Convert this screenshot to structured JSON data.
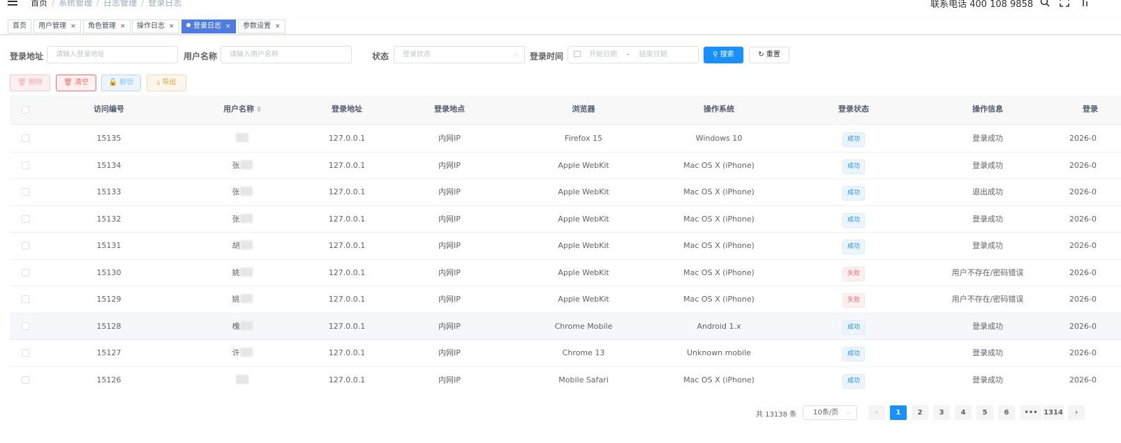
{
  "header": {
    "breadcrumb": [
      "首页",
      "系统管理",
      "日志管理",
      "登录日志"
    ],
    "hotline": "联系电话 400 108 9858"
  },
  "tags": [
    {
      "label": "首页",
      "active": false
    },
    {
      "label": "用户管理",
      "active": false
    },
    {
      "label": "角色管理",
      "active": false
    },
    {
      "label": "操作日志",
      "active": false
    },
    {
      "label": "登录日志",
      "active": true
    },
    {
      "label": "参数设置",
      "active": false
    }
  ],
  "tag_close": "×",
  "filters": {
    "address_label": "登录地址",
    "address_placeholder": "请输入登录地址",
    "username_label": "用户名称",
    "username_placeholder": "请输入用户名称",
    "status_label": "状态",
    "status_placeholder": "登录状态",
    "time_label": "登录时间",
    "start_placeholder": "开始日期",
    "range_sep": "-",
    "end_placeholder": "结束日期",
    "search_label": "搜索",
    "reset_label": "重置"
  },
  "toolbar": {
    "delete_label": "删除",
    "clear_label": "清空",
    "unlock_label": "解锁",
    "export_label": "导出"
  },
  "table": {
    "columns": [
      "访问编号",
      "用户名称",
      "登录地址",
      "登录地点",
      "浏览器",
      "操作系统",
      "登录状态",
      "操作信息",
      "登录"
    ],
    "rows": [
      {
        "id": "15135",
        "user": "",
        "ip": "127.0.0.1",
        "location": "内网IP",
        "browser": "Firefox 15",
        "os": "Windows 10",
        "status": "成功",
        "status_type": "ok",
        "msg": "登录成功",
        "time": "2026-0"
      },
      {
        "id": "15134",
        "user": "张",
        "ip": "127.0.0.1",
        "location": "内网IP",
        "browser": "Apple WebKit",
        "os": "Mac OS X (iPhone)",
        "status": "成功",
        "status_type": "ok",
        "msg": "登录成功",
        "time": "2026-0"
      },
      {
        "id": "15133",
        "user": "张",
        "ip": "127.0.0.1",
        "location": "内网IP",
        "browser": "Apple WebKit",
        "os": "Mac OS X (iPhone)",
        "status": "成功",
        "status_type": "ok",
        "msg": "退出成功",
        "time": "2026-0"
      },
      {
        "id": "15132",
        "user": "张",
        "ip": "127.0.0.1",
        "location": "内网IP",
        "browser": "Apple WebKit",
        "os": "Mac OS X (iPhone)",
        "status": "成功",
        "status_type": "ok",
        "msg": "登录成功",
        "time": "2026-0"
      },
      {
        "id": "15131",
        "user": "胡",
        "ip": "127.0.0.1",
        "location": "内网IP",
        "browser": "Apple WebKit",
        "os": "Mac OS X (iPhone)",
        "status": "成功",
        "status_type": "ok",
        "msg": "登录成功",
        "time": "2026-0"
      },
      {
        "id": "15130",
        "user": "姚",
        "ip": "127.0.0.1",
        "location": "内网IP",
        "browser": "Apple WebKit",
        "os": "Mac OS X (iPhone)",
        "status": "失败",
        "status_type": "fail",
        "msg": "用户不存在/密码错误",
        "time": "2026-0"
      },
      {
        "id": "15129",
        "user": "姚",
        "ip": "127.0.0.1",
        "location": "内网IP",
        "browser": "Apple WebKit",
        "os": "Mac OS X (iPhone)",
        "status": "失败",
        "status_type": "fail",
        "msg": "用户不存在/密码错误",
        "time": "2026-0"
      },
      {
        "id": "15128",
        "user": "槐",
        "ip": "127.0.0.1",
        "location": "内网IP",
        "browser": "Chrome Mobile",
        "os": "Android 1.x",
        "status": "成功",
        "status_type": "ok",
        "msg": "登录成功",
        "time": "2026-0"
      },
      {
        "id": "15127",
        "user": "许",
        "ip": "127.0.0.1",
        "location": "内网IP",
        "browser": "Chrome 13",
        "os": "Unknown mobile",
        "status": "成功",
        "status_type": "ok",
        "msg": "登录成功",
        "time": "2026-0"
      },
      {
        "id": "15126",
        "user": "",
        "ip": "127.0.0.1",
        "location": "内网IP",
        "browser": "Mobile Safari",
        "os": "Mac OS X (iPhone)",
        "status": "成功",
        "status_type": "ok",
        "msg": "登录成功",
        "time": "2026-0"
      }
    ]
  },
  "pagination": {
    "total": "共 13138 条",
    "page_size": "10条/页",
    "prev": "‹",
    "pages": [
      "1",
      "2",
      "3",
      "4",
      "5",
      "6",
      "•••",
      "1314"
    ],
    "current": "1",
    "next": "›"
  },
  "colors": {
    "primary": "#1890ff",
    "danger": "#f56c6c",
    "warning": "#e6a23c",
    "active_tag": "#4f7ce0"
  }
}
